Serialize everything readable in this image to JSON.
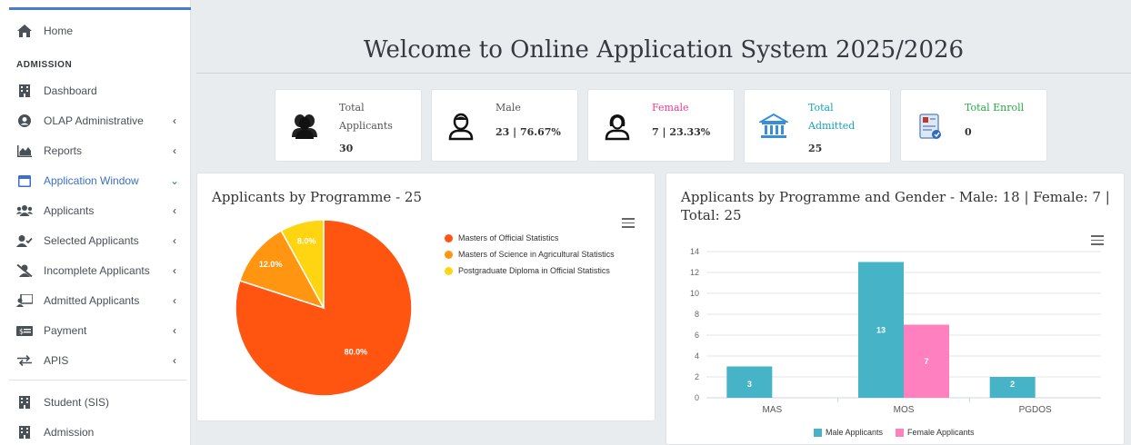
{
  "sidebar": {
    "home": "Home",
    "section_header": "ADMISSION",
    "items": [
      {
        "label": "Dashboard",
        "chevron": ""
      },
      {
        "label": "OLAP Administrative",
        "chevron": "‹"
      },
      {
        "label": "Reports",
        "chevron": "‹"
      },
      {
        "label": "Application Window",
        "chevron": "⌄"
      },
      {
        "label": "Applicants",
        "chevron": "‹"
      },
      {
        "label": "Selected Applicants",
        "chevron": "‹"
      },
      {
        "label": "Incomplete Applicants",
        "chevron": "‹"
      },
      {
        "label": "Admitted Applicants",
        "chevron": "‹"
      },
      {
        "label": "Payment",
        "chevron": "‹"
      },
      {
        "label": "APIS",
        "chevron": "‹"
      }
    ],
    "bottom_items": [
      {
        "label": "Student (SIS)"
      },
      {
        "label": "Admission"
      }
    ]
  },
  "header": {
    "title": "Welcome to Online Application System 2025/2026"
  },
  "stats": [
    {
      "title_line1": "Total",
      "title_line2": "Applicants",
      "value": "30",
      "color": "#555555"
    },
    {
      "title_line1": "Male",
      "title_line2": "",
      "value": "23 | 76.67%",
      "color": "#555555"
    },
    {
      "title_line1": "Female",
      "title_line2": "",
      "value": "7 | 23.33%",
      "color": "#e83e8c"
    },
    {
      "title_line1": "Total",
      "title_line2": "Admitted",
      "value": "25",
      "color": "#17a2b8"
    },
    {
      "title_line1": "Total Enroll",
      "title_line2": "",
      "value": "0",
      "color": "#28a745"
    }
  ],
  "pie": {
    "title": "Applicants by Programme - 25",
    "legend": [
      "Masters of Official Statistics",
      "Masters of Science in Agricultural Statistics",
      "Postgraduate Diploma in Official Statistics"
    ],
    "labels": [
      "80.0%",
      "12.0%",
      "8.0%"
    ]
  },
  "bar": {
    "title_line1": "Applicants by Programme and Gender - Male: 18 | Female: 7 |",
    "title_line2": "Total: 25",
    "legend": [
      "Male Applicants",
      "Female Applicants"
    ]
  },
  "chart_data": [
    {
      "type": "pie",
      "title": "Applicants by Programme - 25",
      "categories": [
        "Masters of Official Statistics",
        "Masters of Science in Agricultural Statistics",
        "Postgraduate Diploma in Official Statistics"
      ],
      "values": [
        80.0,
        12.0,
        8.0
      ],
      "colors": [
        "#ff5511",
        "#ff9511",
        "#ffd511"
      ],
      "legend": "right"
    },
    {
      "type": "bar",
      "title": "Applicants by Programme and Gender - Male: 18 | Female: 7 | Total: 25",
      "categories": [
        "MAS",
        "MOS",
        "PGDOS"
      ],
      "series": [
        {
          "name": "Male Applicants",
          "values": [
            3,
            13,
            2
          ],
          "color": "#46b3c7"
        },
        {
          "name": "Female Applicants",
          "values": [
            0,
            7,
            0
          ],
          "color": "#ff80bf"
        }
      ],
      "yticks": [
        "0",
        "2",
        "4",
        "6",
        "8",
        "10",
        "12",
        "14"
      ],
      "ylim": [
        0,
        14
      ],
      "grid": true,
      "legend": "bottom"
    }
  ]
}
